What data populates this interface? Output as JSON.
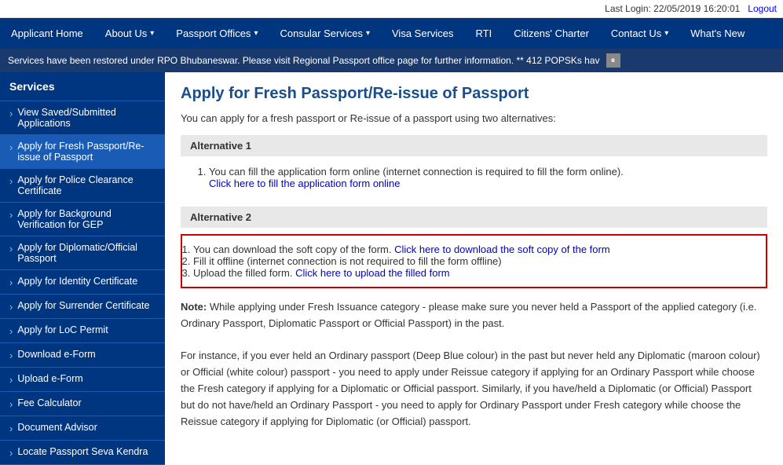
{
  "topbar": {
    "last_login_label": "Last Login: 22/05/2019 16:20:01",
    "logout_label": "Logout"
  },
  "nav": {
    "items": [
      {
        "id": "applicant-home",
        "label": "Applicant Home",
        "has_dropdown": false
      },
      {
        "id": "about-us",
        "label": "About Us",
        "has_dropdown": true
      },
      {
        "id": "passport-offices",
        "label": "Passport Offices",
        "has_dropdown": true
      },
      {
        "id": "consular-services",
        "label": "Consular Services",
        "has_dropdown": true
      },
      {
        "id": "visa-services",
        "label": "Visa Services",
        "has_dropdown": false
      },
      {
        "id": "rti",
        "label": "RTI",
        "has_dropdown": false
      },
      {
        "id": "citizens-charter",
        "label": "Citizens' Charter",
        "has_dropdown": false
      },
      {
        "id": "contact-us",
        "label": "Contact Us",
        "has_dropdown": true
      },
      {
        "id": "whats-new",
        "label": "What's New",
        "has_dropdown": false
      }
    ]
  },
  "ticker": {
    "text": "Services have been restored under RPO Bhubaneswar. Please visit Regional Passport office page for further information. ** 412 POPSKs hav"
  },
  "sidebar": {
    "title": "Services",
    "items": [
      {
        "id": "view-saved",
        "label": "View Saved/Submitted Applications"
      },
      {
        "id": "fresh-passport",
        "label": "Apply for Fresh Passport/Re-issue of Passport",
        "active": true
      },
      {
        "id": "police-clearance",
        "label": "Apply for Police Clearance Certificate"
      },
      {
        "id": "background-verification",
        "label": "Apply for Background Verification for GEP"
      },
      {
        "id": "diplomatic-passport",
        "label": "Apply for Diplomatic/Official Passport"
      },
      {
        "id": "identity-certificate",
        "label": "Apply for Identity Certificate"
      },
      {
        "id": "surrender-certificate",
        "label": "Apply for Surrender Certificate"
      },
      {
        "id": "loc-permit",
        "label": "Apply for LoC Permit"
      },
      {
        "id": "download-eform",
        "label": "Download e-Form"
      },
      {
        "id": "upload-eform",
        "label": "Upload e-Form"
      },
      {
        "id": "fee-calculator",
        "label": "Fee Calculator"
      },
      {
        "id": "document-advisor",
        "label": "Document Advisor"
      },
      {
        "id": "locate-passport",
        "label": "Locate Passport Seva Kendra"
      }
    ]
  },
  "content": {
    "page_title": "Apply for Fresh Passport/Re-issue of Passport",
    "intro": "You can apply for a fresh passport or Re-issue of a passport using two alternatives:",
    "alt1": {
      "heading": "Alternative 1",
      "item1": "You can fill the application form online (internet connection is required to fill the form online).",
      "link1_text": "Click here to fill the application form online",
      "link1_href": "#"
    },
    "alt2": {
      "heading": "Alternative 2",
      "item1_prefix": "You can download the soft copy of the form. ",
      "item1_link_text": "Click here to download the soft copy of the form",
      "item1_link_href": "#",
      "item2": "Fill it offline (internet connection is not required to fill the form offline)",
      "item3_prefix": "Upload the filled form. ",
      "item3_link_text": "Click here to upload the filled form",
      "item3_link_href": "#"
    },
    "note": {
      "bold_prefix": "Note:",
      "para1": " While applying under Fresh Issuance category - please make sure you never held a Passport of the applied category (i.e. Ordinary Passport, Diplomatic Passport or Official Passport) in the past.",
      "para2": "For instance, if you ever held an Ordinary passport (Deep Blue colour) in the past but never held any Diplomatic (maroon colour) or Official (white colour) passport - you need to apply under Reissue category if applying for an Ordinary Passport while choose the Fresh category if applying for a Diplomatic or Official passport. Similarly, if you have/held a Diplomatic (or Official) Passport but do not have/held an Ordinary Passport - you need to apply for Ordinary Passport under Fresh category while choose the Reissue category if applying for Diplomatic (or Official) passport."
    }
  }
}
